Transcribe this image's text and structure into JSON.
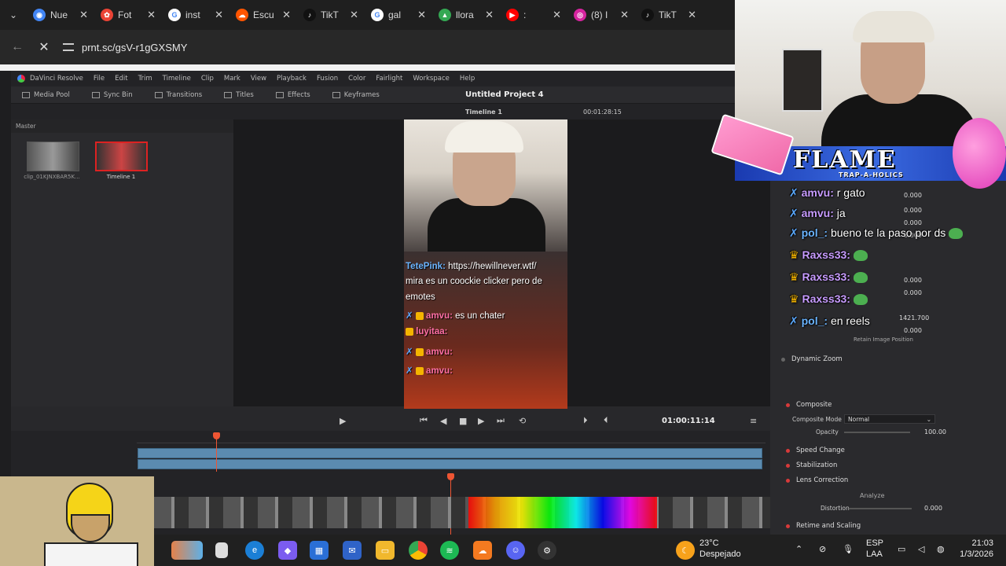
{
  "browser": {
    "tabs": [
      {
        "label": "Nue",
        "color": "#4285f4",
        "glyph": "◉"
      },
      {
        "label": "Fot",
        "color": "#ea4335",
        "glyph": "✿"
      },
      {
        "label": "inst",
        "color": "#ffffff",
        "glyph": "G"
      },
      {
        "label": "Escu",
        "color": "#ff5500",
        "glyph": "☁"
      },
      {
        "label": "TikT",
        "color": "#111111",
        "glyph": "♪"
      },
      {
        "label": "gal",
        "color": "#ffffff",
        "glyph": "G"
      },
      {
        "label": "llora",
        "color": "#34a853",
        "glyph": "▲"
      },
      {
        "label": ":",
        "color": "#ff0000",
        "glyph": "▶"
      },
      {
        "label": "(8) I",
        "color": "#d6249f",
        "glyph": "◎"
      },
      {
        "label": "TikT",
        "color": "#111111",
        "glyph": "♪"
      }
    ],
    "close_glyph": "✕",
    "url": "prnt.sc/gsV-r1gGXSMY",
    "back_glyph": "←",
    "reload_glyph": "✕"
  },
  "resolve": {
    "menu": [
      "DaVinci Resolve",
      "File",
      "Edit",
      "Trim",
      "Timeline",
      "Clip",
      "Mark",
      "View",
      "Playback",
      "Fusion",
      "Color",
      "Fairlight",
      "Workspace",
      "Help"
    ],
    "toolbar": [
      "Media Pool",
      "Sync Bin",
      "Transitions",
      "Titles",
      "Effects",
      "Keyframes"
    ],
    "project_title": "Untitled Project 4",
    "timeline_name": "Timeline 1",
    "timeline_tc": "00:01:28:15",
    "bin_label": "Master",
    "clips": [
      {
        "label": "clip_01KJNXBAR5K..."
      },
      {
        "label": "Timeline 1"
      }
    ],
    "transport_tc": "01:00:11:14"
  },
  "viewer_chat": [
    {
      "name": "TetePink:",
      "text": " https://hewillnever.wtf/"
    },
    {
      "name": "",
      "text": "mira es un coockie clicker pero de"
    },
    {
      "name": "",
      "text": "emotes"
    },
    {
      "name": "amvu:",
      "text": " es un chater"
    },
    {
      "name": "luyitaa:",
      "text": ""
    },
    {
      "name": "amvu:",
      "text": ""
    },
    {
      "name": "amvu:",
      "text": ""
    }
  ],
  "stream_chat": [
    {
      "name": "amvu:",
      "text": " r gato",
      "style": "purple",
      "prefix": "✗"
    },
    {
      "name": "amvu:",
      "text": " ja",
      "style": "purple",
      "prefix": "✗"
    },
    {
      "name": "pol_:",
      "text": " bueno te la paso por ds",
      "style": "blue",
      "prefix": "✗"
    },
    {
      "name": "Raxss33:",
      "text": "",
      "style": "purple",
      "prefix": "♛"
    },
    {
      "name": "Raxss33:",
      "text": "",
      "style": "purple",
      "prefix": "♛"
    },
    {
      "name": "Raxss33:",
      "text": "",
      "style": "purple",
      "prefix": "♛"
    },
    {
      "name": "pol_:",
      "text": " en reels",
      "style": "blue",
      "prefix": "✗"
    }
  ],
  "inspector": {
    "values_top": [
      "0.000",
      "0.000",
      "0.000",
      "0.000",
      "0.000",
      "0.000",
      "1421.700",
      "0.000"
    ],
    "retain": "Retain Image Position",
    "dynamic_zoom": "Dynamic Zoom",
    "composite": "Composite",
    "composite_mode_label": "Composite Mode",
    "composite_mode_value": "Normal",
    "opacity_label": "Opacity",
    "opacity_value": "100.00",
    "speed_change": "Speed Change",
    "stabilization": "Stabilization",
    "lens_correction": "Lens Correction",
    "analyze": "Analyze",
    "distortion_label": "Distortion",
    "distortion_value": "0.000",
    "retime": "Retime and Scaling"
  },
  "overlay": {
    "flame_title": "FLAME",
    "flame_sub": "TRAP-A-HOLICS"
  },
  "taskbar": {
    "weather_temp": "23°C",
    "weather_desc": "Despejado",
    "lang": "ESP",
    "region": "LAA",
    "time": "21:03",
    "date": "1/3/2026"
  }
}
